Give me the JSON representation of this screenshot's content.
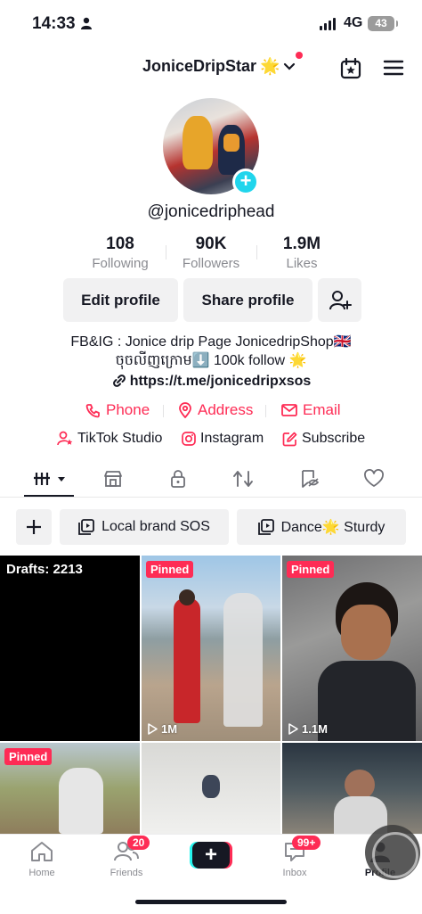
{
  "status_bar": {
    "time": "14:33",
    "network": "4G",
    "battery": "43"
  },
  "header": {
    "username": "JoniceDripStar",
    "username_emoji": "🌟"
  },
  "profile": {
    "handle": "@jonicedriphead",
    "stats": [
      {
        "value": "108",
        "label": "Following"
      },
      {
        "value": "90K",
        "label": "Followers"
      },
      {
        "value": "1.9M",
        "label": "Likes"
      }
    ],
    "edit_label": "Edit profile",
    "share_label": "Share profile",
    "bio_line1": "FB&IG : Jonice drip Page JonicedripShop🇬🇧",
    "bio_line2": "ចុចលីញក្រោម⬇️ 100k follow 🌟",
    "link": "https://t.me/jonicedripxsos",
    "contacts": [
      "Phone",
      "Address",
      "Email"
    ],
    "links": [
      "TikTok Studio",
      "Instagram",
      "Subscribe"
    ]
  },
  "collections": {
    "local": "Local brand SOS",
    "dance": "Dance🌟 Sturdy"
  },
  "grid": {
    "drafts": "Drafts: 2213",
    "pinned_label": "Pinned",
    "views": [
      "1M",
      "1.1M"
    ]
  },
  "bottom_nav": {
    "home": "Home",
    "friends": "Friends",
    "friends_badge": "20",
    "inbox": "Inbox",
    "inbox_badge": "99+",
    "profile": "Profile"
  },
  "colors": {
    "accent": "#fe2c55",
    "cyan": "#20d5ec",
    "text": "#161823",
    "muted": "#8a8b91"
  }
}
